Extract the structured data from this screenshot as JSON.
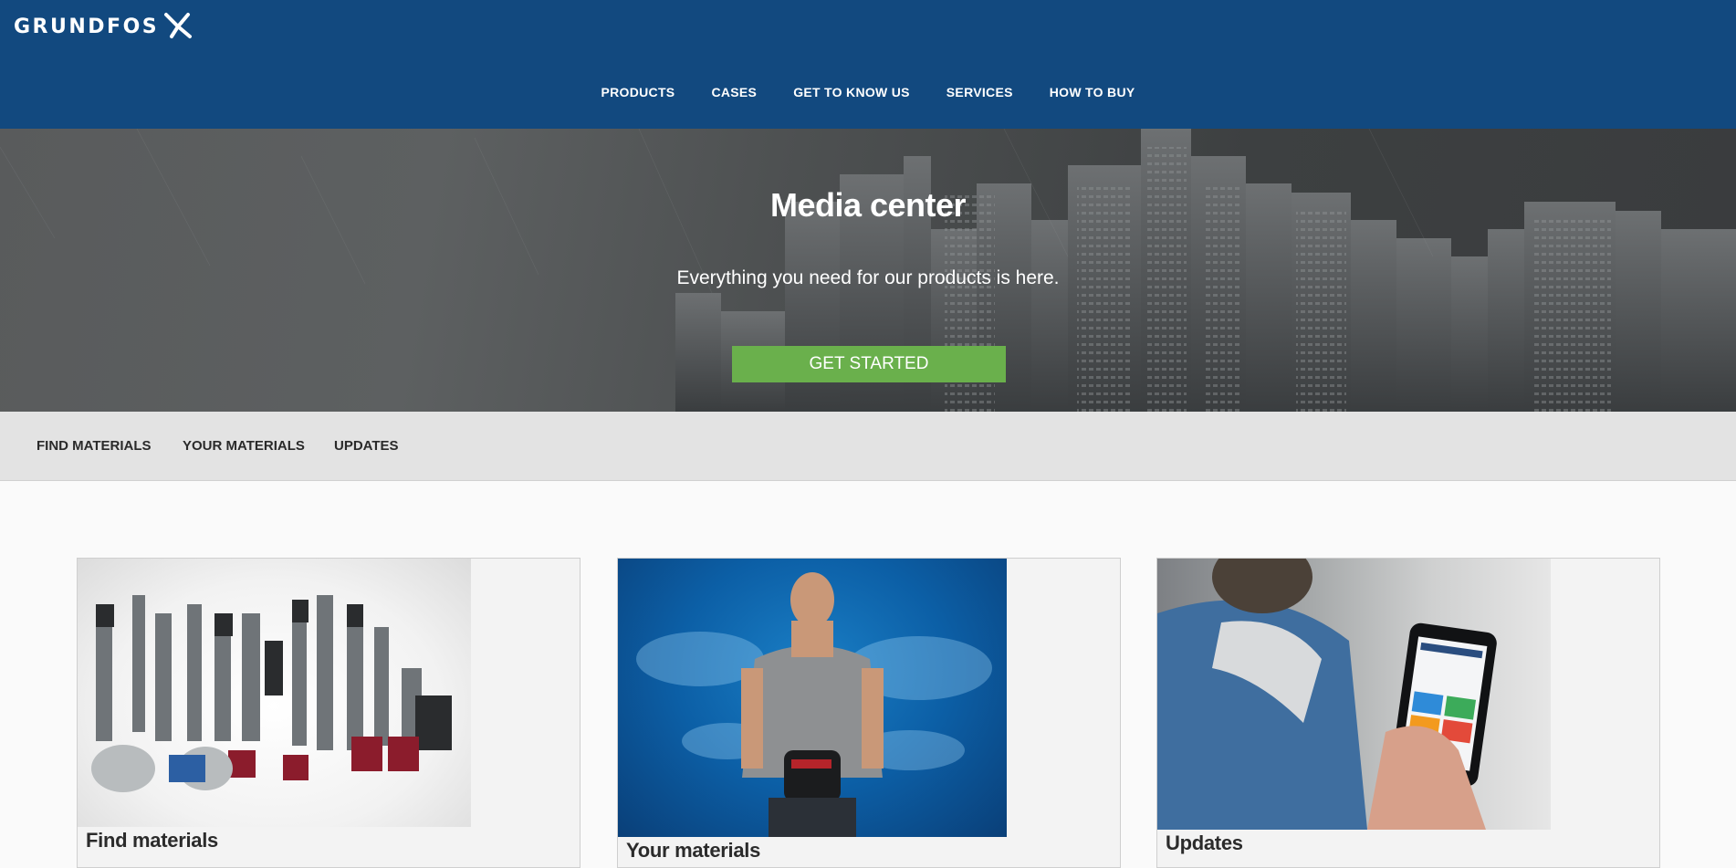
{
  "header": {
    "logo_text": "GRUNDFOS",
    "nav": [
      "PRODUCTS",
      "CASES",
      "GET TO KNOW US",
      "SERVICES",
      "HOW TO BUY"
    ]
  },
  "hero": {
    "title": "Media center",
    "subtitle": "Everything you need for our products is here.",
    "button_label": "GET STARTED"
  },
  "subnav": {
    "items": [
      "FIND MATERIALS",
      "YOUR MATERIALS",
      "UPDATES"
    ]
  },
  "cards": [
    {
      "title": "Find materials",
      "image": "pumps-product-range"
    },
    {
      "title": "Your materials",
      "image": "man-holding-pump-blue-water"
    },
    {
      "title": "Updates",
      "image": "hand-holding-smartphone"
    }
  ],
  "colors": {
    "header_bg": "#12497f",
    "accent_green": "#6ab04c",
    "subnav_bg": "#e3e3e3",
    "card_bg": "#f3f3f3"
  }
}
